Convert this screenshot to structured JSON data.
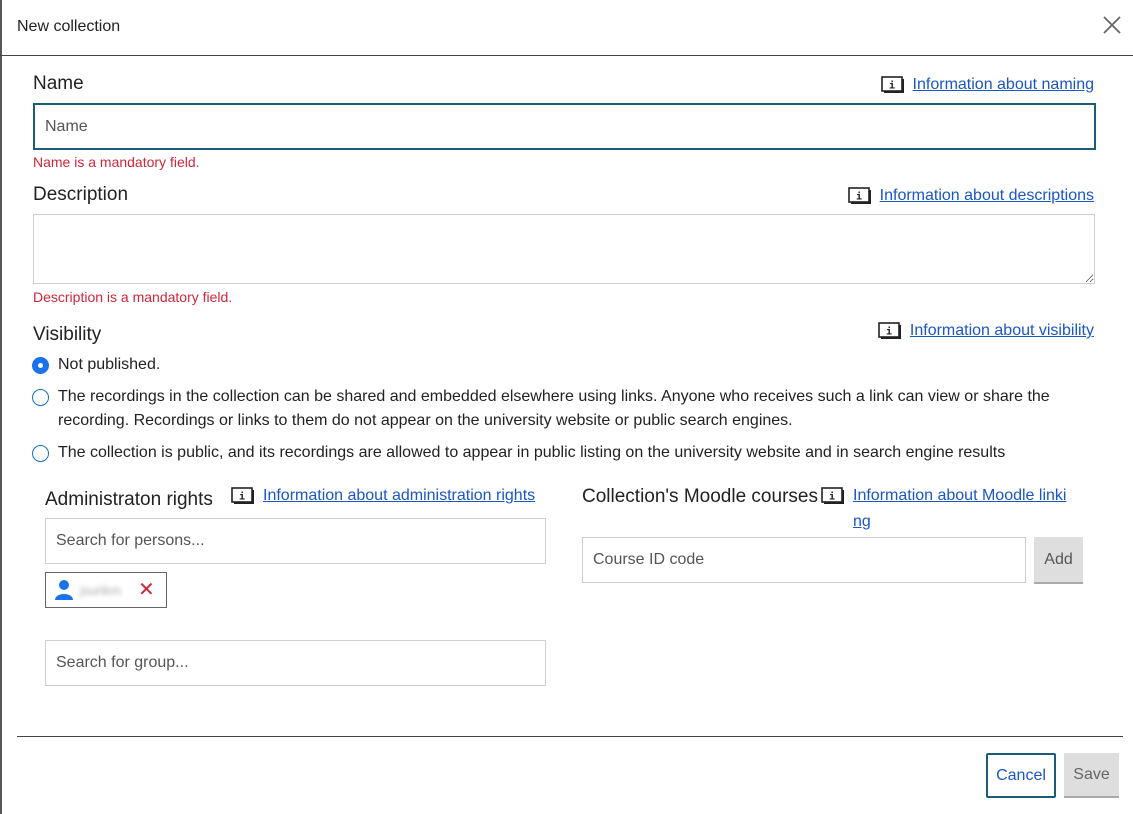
{
  "dialog": {
    "title": "New collection"
  },
  "name_section": {
    "label": "Name",
    "info_link": "Information about naming",
    "placeholder": "Name",
    "value": "",
    "error": "Name is a mandatory field."
  },
  "description_section": {
    "label": "Description",
    "info_link": "Information about descriptions",
    "value": "",
    "error": "Description is a mandatory field."
  },
  "visibility_section": {
    "label": "Visibility",
    "info_link": "Information about visibility",
    "options": [
      {
        "label": "Not published.",
        "checked": true
      },
      {
        "label": "The recordings in the collection can be shared and embedded elsewhere using links. Anyone who receives such a link can view or share the recording. Recordings or links to them do not appear on the university website or public search engines.",
        "checked": false
      },
      {
        "label": "The collection is public, and its recordings are allowed to appear in public listing on the university website and in search engine results",
        "checked": false
      }
    ]
  },
  "admin_section": {
    "label": "Administraton rights",
    "info_link": "Information about administration rights",
    "person_search_placeholder": "Search for persons...",
    "group_search_placeholder": "Search for group...",
    "selected_person": {
      "name": "jsurikm",
      "remove_symbol": "✕"
    }
  },
  "moodle_section": {
    "label": "Collection's Moodle courses",
    "info_link": "Information about Moodle linking",
    "course_placeholder": "Course ID code",
    "add_label": "Add"
  },
  "footer": {
    "cancel_label": "Cancel",
    "save_label": "Save"
  },
  "colors": {
    "link": "#1a56c4",
    "error": "#d0263b",
    "focus_border": "#1c5c78",
    "radio_accent": "#1a73e8"
  },
  "icons": {
    "close": "close-icon",
    "info": "info-icon",
    "person": "person-icon",
    "remove": "remove-icon"
  }
}
